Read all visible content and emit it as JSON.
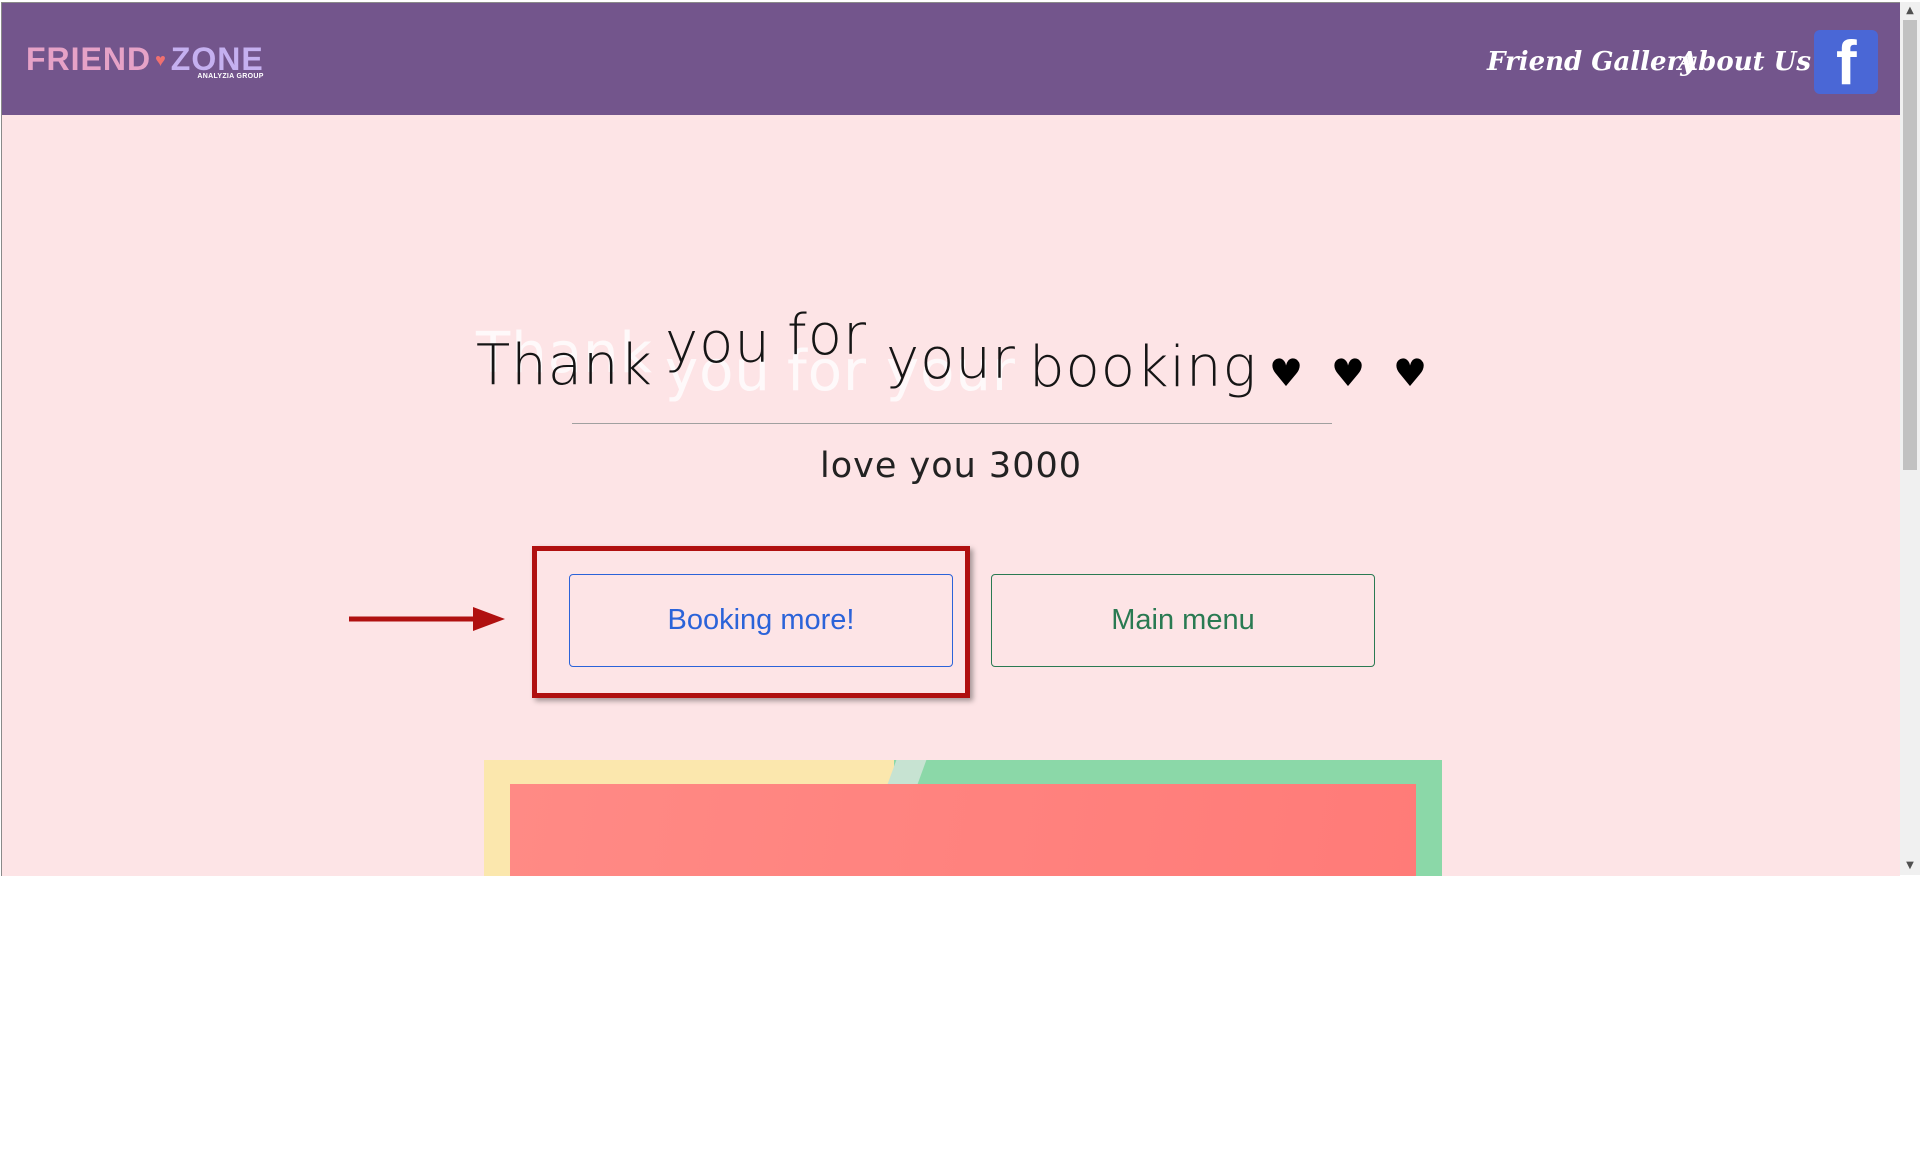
{
  "brand": {
    "logo_part1": "FRIEND",
    "logo_part2": "ZONE",
    "logo_sub": "ANALYZIA GROUP"
  },
  "nav": {
    "links": [
      {
        "label": "Friend Gallery"
      },
      {
        "label": "About Us"
      }
    ],
    "social_icon": "facebook-icon"
  },
  "hero": {
    "headline_words": [
      "Thank",
      "you",
      "for",
      "your",
      "booking"
    ],
    "hearts": [
      "♥",
      "♥",
      "♥"
    ],
    "tagline": "love you 3000"
  },
  "actions": {
    "primary_label": "Booking more!",
    "secondary_label": "Main menu"
  },
  "annotation": {
    "highlight_color": "#b01010",
    "target": "primary-button"
  },
  "colors": {
    "navbar": "#73558c",
    "page_bg": "#fde4e6",
    "primary": "#2b63d9",
    "secondary": "#2a7a52",
    "banner_yellow": "#fbe7ad",
    "banner_green": "#8bd8a8",
    "banner_coral": "#ff8a85"
  }
}
